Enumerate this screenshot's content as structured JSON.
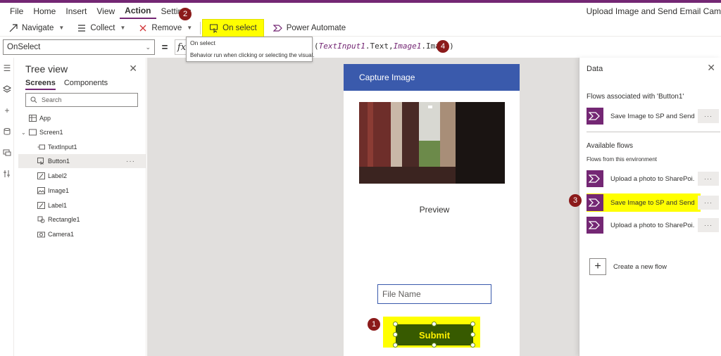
{
  "app_title": "Upload Image and Send Email Cam",
  "menu": [
    "File",
    "Home",
    "Insert",
    "View",
    "Action",
    "Settings"
  ],
  "active_menu": "Action",
  "toolbar": {
    "navigate": "Navigate",
    "collect": "Collect",
    "remove": "Remove",
    "on_select": "On select",
    "power_automate": "Power Automate"
  },
  "formula_bar": {
    "property": "OnSelect",
    "equals": "=",
    "fx": "fx",
    "formula_part1": "TextInput1",
    "formula_part2": ".Text,",
    "formula_part3": "Image1",
    "formula_part4": ".Image)",
    "formula_prefix": "("
  },
  "tooltip": {
    "title": "On select",
    "description": "Behavior run when clicking or selecting the visual."
  },
  "badges": [
    "1",
    "2",
    "3",
    "4"
  ],
  "tree_view": {
    "title": "Tree view",
    "tabs": [
      "Screens",
      "Components"
    ],
    "search_placeholder": "Search",
    "items": [
      {
        "label": "App"
      },
      {
        "label": "Screen1"
      },
      {
        "label": "TextInput1"
      },
      {
        "label": "Button1"
      },
      {
        "label": "Label2"
      },
      {
        "label": "Image1"
      },
      {
        "label": "Label1"
      },
      {
        "label": "Rectangle1"
      },
      {
        "label": "Camera1"
      }
    ],
    "more": "···"
  },
  "canvas": {
    "header": "Capture Image",
    "preview_label": "Preview",
    "file_name_placeholder": "File Name",
    "submit_label": "Submit"
  },
  "data_panel": {
    "title": "Data",
    "associated_heading": "Flows associated with 'Button1'",
    "associated_flows": [
      "Save Image to SP and Send..."
    ],
    "available_heading": "Available flows",
    "available_sub": "Flows from this environment",
    "available_flows": [
      "Upload a photo to SharePoi...",
      "Save Image to SP and Send...",
      "Upload a photo to SharePoi..."
    ],
    "more": "···",
    "create_new": "Create a new flow"
  },
  "colors": {
    "brand": "#742774",
    "highlight": "#ffff00",
    "badge": "#8b1a1a",
    "canvas_header": "#3a5aac",
    "submit_bg": "#375a00"
  }
}
